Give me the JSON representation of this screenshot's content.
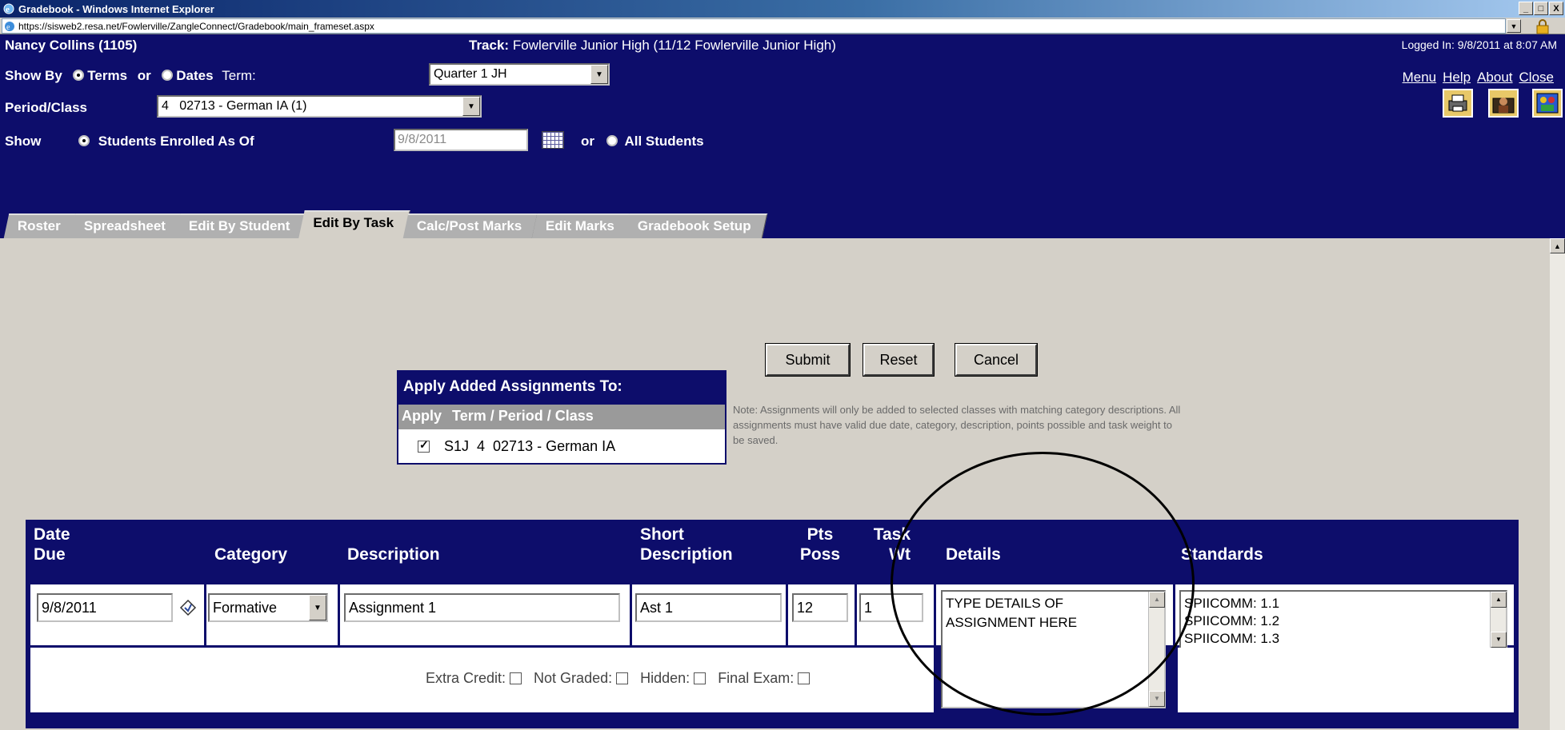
{
  "window": {
    "title": "Gradebook - Windows Internet Explorer",
    "url": "https://sisweb2.resa.net/Fowlerville/ZangleConnect/Gradebook/main_frameset.aspx",
    "minimize": "_",
    "maximize": "□",
    "close": "X"
  },
  "header": {
    "teacher": "Nancy Collins (1105)",
    "track_label": "Track:",
    "track_value": "Fowlerville Junior High (11/12 Fowlerville Junior High)",
    "logged_in": "Logged In: 9/8/2011 at 8:07 AM",
    "show_by_label": "Show By",
    "terms_label": "Terms",
    "or_label": "or",
    "dates_label": "Dates",
    "term_label": "Term:",
    "term_value": "Quarter 1 JH",
    "period_label": "Period/Class",
    "period_value": "4   02713 - German IA (1)",
    "show_label": "Show",
    "enrolled_label": "Students Enrolled As Of",
    "enrolled_date": "9/8/2011",
    "or2_label": "or",
    "all_students_label": "All Students",
    "links": [
      "Menu",
      "Help",
      "About",
      "Close"
    ]
  },
  "tabs": [
    {
      "label": "Roster",
      "active": false
    },
    {
      "label": "Spreadsheet",
      "active": false
    },
    {
      "label": "Edit By Student",
      "active": false
    },
    {
      "label": "Edit By Task",
      "active": true
    },
    {
      "label": "Calc/Post Marks",
      "active": false
    },
    {
      "label": "Edit Marks",
      "active": false
    },
    {
      "label": "Gradebook Setup",
      "active": false
    }
  ],
  "apply": {
    "title": "Apply Added Assignments To:",
    "col_apply": "Apply",
    "col_class": "Term / Period / Class",
    "row_class": "S1J  4  02713 - German IA",
    "checked": true
  },
  "buttons": {
    "submit": "Submit",
    "reset": "Reset",
    "cancel": "Cancel"
  },
  "note": "Note: Assignments will only be added to selected classes with matching category descriptions. All assignments must have valid due date, category, description, points possible and task weight to be saved.",
  "grid": {
    "headers": {
      "date_due_1": "Date",
      "date_due_2": "Due",
      "category": "Category",
      "description": "Description",
      "short_1": "Short",
      "short_2": "Description",
      "pts_1": "Pts",
      "pts_2": "Poss",
      "task_1": "Task",
      "task_2": "Wt",
      "details": "Details",
      "standards": "Standards"
    },
    "row": {
      "date_due": "9/8/2011",
      "category": "Formative",
      "description": "Assignment 1",
      "short_description": "Ast 1",
      "pts_poss": "12",
      "task_wt": "1",
      "details": "TYPE DETAILS OF ASSIGNMENT HERE",
      "standards": [
        "SPIICOMM: 1.1",
        "SPIICOMM: 1.2",
        "SPIICOMM: 1.3"
      ]
    },
    "flags": {
      "extra_credit": "Extra Credit:",
      "not_graded": "Not Graded:",
      "hidden": "Hidden:",
      "final_exam": "Final Exam:"
    }
  },
  "colors": {
    "header_bg": "#0d0d6b",
    "content_bg": "#d4d0c8",
    "annotation": "#000000"
  }
}
